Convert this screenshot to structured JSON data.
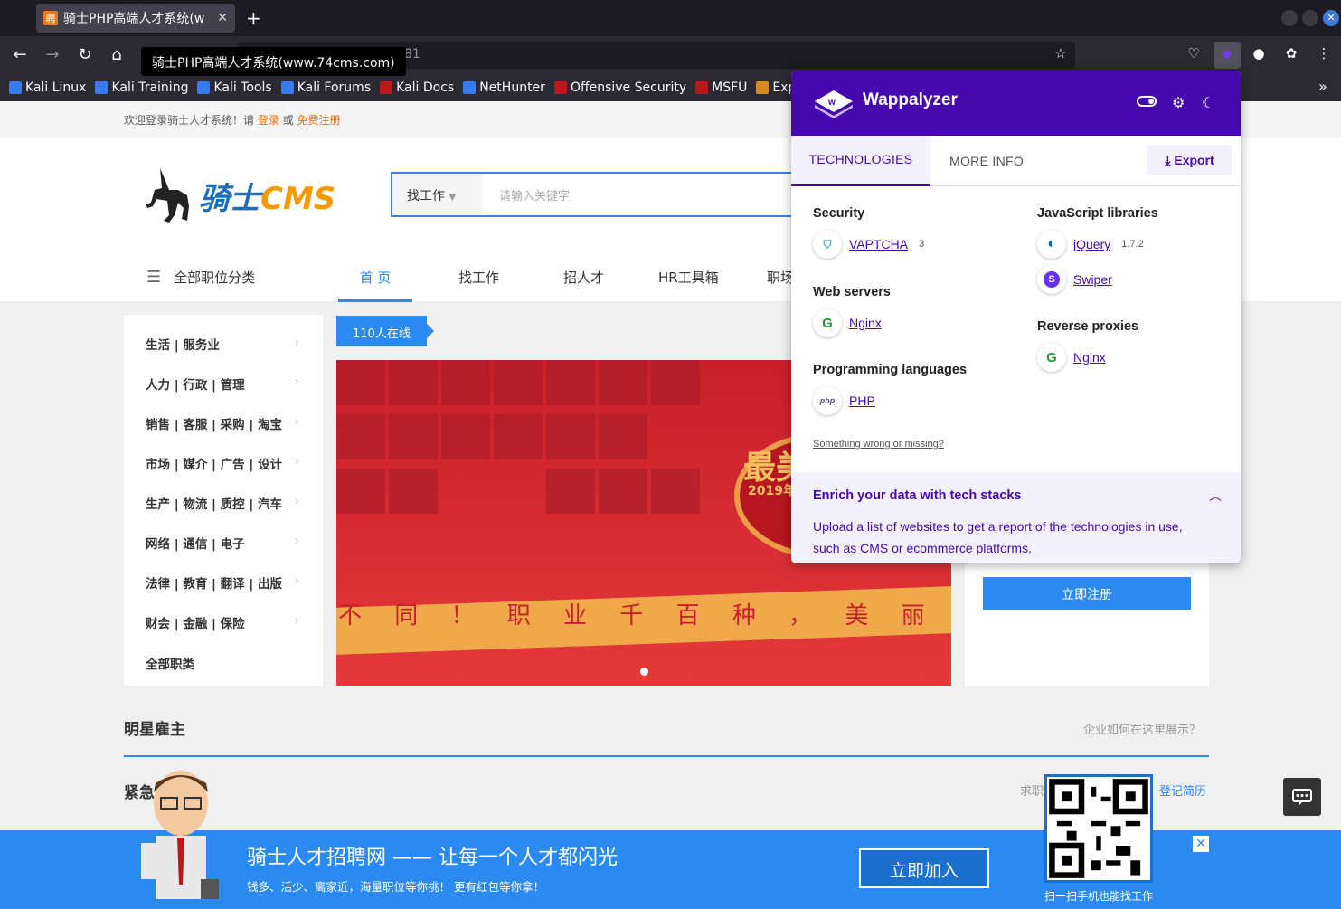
{
  "browser": {
    "tab_title": "骑士PHP高端人才系统(w",
    "tab_favicon": "聘",
    "url": "192.168.150.135:81",
    "tooltip": "骑士PHP高端人才系统(www.74cms.com)",
    "bookmarks": [
      "Kali Linux",
      "Kali Training",
      "Kali Tools",
      "Kali Forums",
      "Kali Docs",
      "NetHunter",
      "Offensive Security",
      "MSFU",
      "Exp"
    ]
  },
  "page": {
    "welcome_prefix": "欢迎登录骑士人才系统！请",
    "login": "登录",
    "or": "或",
    "register": "免费注册",
    "logo_text_a": "骑士",
    "logo_text_b": "CMS",
    "search_select": "找工作",
    "search_placeholder": "请输入关键字",
    "all_categories": "全部职位分类",
    "nav": [
      "首 页",
      "找工作",
      "招人才",
      "HR工具箱",
      "职场"
    ],
    "sidebar": [
      "生活 | 服务业",
      "人力 | 行政 | 管理",
      "销售 | 客服 | 采购 | 淘宝",
      "市场 | 媒介 | 广告 | 设计",
      "生产 | 物流 | 质控 | 汽车",
      "网络 | 通信 | 电子",
      "法律 | 教育 | 翻译 | 出版",
      "财会 | 金融 | 保险",
      "全部职类"
    ],
    "online": "110人在线",
    "banner_big": "最美",
    "banner_year": "2019年",
    "banner_band": "不 同 ！  职 业 千 百 种 ， 美 丽 你",
    "register_now": "立即注册",
    "sec1_title": "明星雇主",
    "sec1_right": "企业如何在这里展示？",
    "sec2_title": "紧急",
    "sec2_right": "求职",
    "sec2_link": "登记简历",
    "bottom_title": "骑士人才招聘网 —— 让每一个人才都闪光",
    "bottom_sub": "钱多、活少、离家近，海量职位等你挑！ 更有红包等你拿！",
    "bottom_btn": "立即加入",
    "qr_text": "扫一扫手机也能找工作",
    "close": "✕"
  },
  "wappalyzer": {
    "title": "Wappalyzer",
    "tab_tech": "TECHNOLOGIES",
    "tab_more": "MORE INFO",
    "export": "Export",
    "security": "Security",
    "vaptcha": "VAPTCHA",
    "vaptcha_count": "3",
    "web_servers": "Web servers",
    "nginx": "Nginx",
    "prog_lang": "Programming languages",
    "php": "PHP",
    "js_libs": "JavaScript libraries",
    "jquery": "jQuery",
    "jquery_ver": "1.7.2",
    "swiper": "Swiper",
    "reverse_proxies": "Reverse proxies",
    "nginx2": "Nginx",
    "wrong": "Something wrong or missing?",
    "enrich_title": "Enrich your data with tech stacks",
    "enrich_text": "Upload a list of websites to get a report of the technologies in use, such as CMS or ecommerce platforms.",
    "accent": "#4608ad"
  }
}
